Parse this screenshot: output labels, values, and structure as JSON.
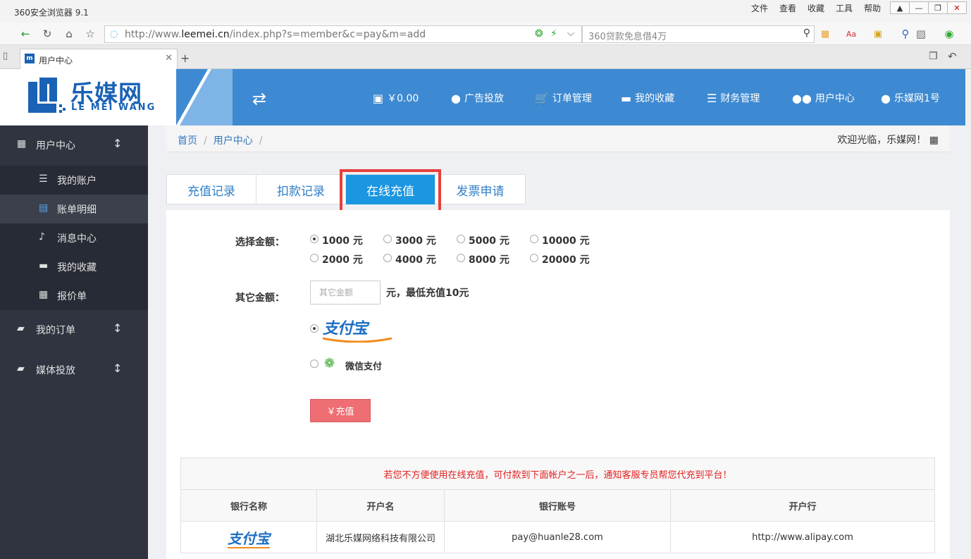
{
  "browser": {
    "title": "360安全浏览器 9.1",
    "menus": [
      "文件",
      "查看",
      "收藏",
      "工具",
      "帮助"
    ],
    "url_prefix": "http://www.",
    "url_domain": "leemei.cn",
    "url_path": "/index.php?s=member&c=pay&m=add",
    "search_text": "360贷款免息借4万",
    "tab_title": "用户中心"
  },
  "header": {
    "logo_cn": "乐媒网",
    "logo_en": "LE MEI WANG",
    "nav": [
      {
        "icon": "wallet-icon",
        "label": "￥0.00"
      },
      {
        "icon": "user-icon",
        "label": "广告投放"
      },
      {
        "icon": "cart-icon",
        "label": "订单管理"
      },
      {
        "icon": "folder-icon",
        "label": "我的收藏"
      },
      {
        "icon": "database-icon",
        "label": "财务管理"
      },
      {
        "icon": "users-icon",
        "label": "用户中心"
      },
      {
        "icon": "user-icon",
        "label": "乐媒网1号"
      }
    ]
  },
  "sidebar": {
    "sections": [
      {
        "label": "用户中心",
        "icon": "building-icon"
      },
      {
        "label": "我的订单",
        "icon": "book-icon"
      },
      {
        "label": "媒体投放",
        "icon": "book-icon"
      }
    ],
    "sub_items": [
      {
        "label": "我的账户",
        "icon": "database-icon"
      },
      {
        "label": "账单明细",
        "icon": "file-icon"
      },
      {
        "label": "消息中心",
        "icon": "bell-icon"
      },
      {
        "label": "我的收藏",
        "icon": "folder-icon"
      },
      {
        "label": "报价单",
        "icon": "calendar-icon"
      }
    ]
  },
  "breadcrumb": {
    "items": [
      "首页",
      "用户中心"
    ],
    "sep": "/",
    "welcome": "欢迎光临，乐媒网！"
  },
  "tabs": [
    "充值记录",
    "扣款记录",
    "在线充值",
    "发票申请"
  ],
  "form": {
    "amount_label": "选择金额：",
    "amounts": [
      "1000 元",
      "3000 元",
      "5000 元",
      "10000 元",
      "2000 元",
      "4000 元",
      "8000 元",
      "20000 元"
    ],
    "other_label": "其它金额：",
    "other_placeholder": "其它金额",
    "other_hint": "元，最低充值10元",
    "alipay_logo": "支付宝",
    "wechat_label": "微信支付",
    "pay_button": "￥充值"
  },
  "bank_table": {
    "notice": "若您不方便使用在线充值，可付款到下面帐户之一后，通知客服专员帮您代充到平台！",
    "headers": [
      "银行名称",
      "开户名",
      "银行账号",
      "开户行"
    ],
    "rows": [
      {
        "bank": "支付宝",
        "name": "湖北乐媒网络科技有限公司",
        "account": "pay@huanle28.com",
        "branch": "http://www.alipay.com"
      }
    ]
  }
}
